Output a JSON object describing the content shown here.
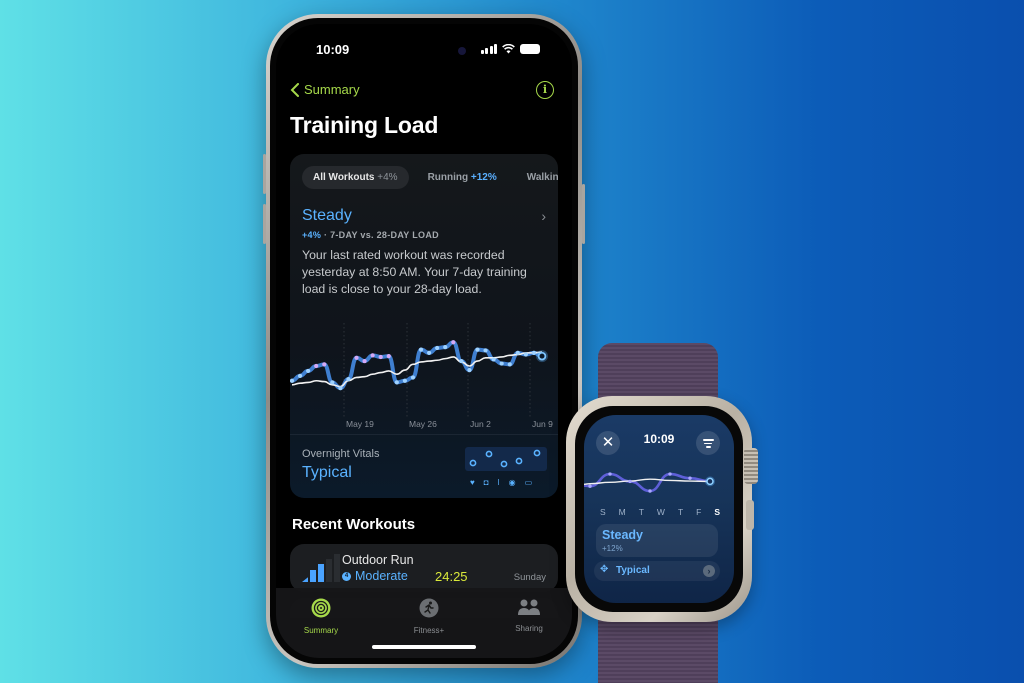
{
  "colors": {
    "accent_green": "#a6d94a",
    "accent_blue": "#5ab2ff",
    "time_yellow": "#d9e83a",
    "high_load_purple": "#b27bdc"
  },
  "phone": {
    "status_bar": {
      "time": "10:09"
    },
    "nav": {
      "back_label": "Summary",
      "info_icon": "info-icon"
    },
    "title": "Training Load",
    "tabs": [
      {
        "label": "All Workouts",
        "delta": "+4%",
        "active": true
      },
      {
        "label": "Running",
        "delta": "+12%",
        "active": false
      },
      {
        "label": "Walkin",
        "delta": "",
        "active": false
      }
    ],
    "load": {
      "state": "Steady",
      "change": "+4%",
      "comparison": "· 7-DAY vs. 28-DAY LOAD",
      "description": "Your last rated workout was recorded yesterday at 8:50 AM. Your 7-day training load is close to your 28-day load."
    },
    "chart_data": {
      "type": "line",
      "x_ticks": [
        "May 19",
        "May 26",
        "Jun 2",
        "Jun 9"
      ],
      "series": [
        {
          "name": "7-day load",
          "values": [
            0.32,
            0.38,
            0.44,
            0.5,
            0.52,
            0.3,
            0.23,
            0.34,
            0.6,
            0.56,
            0.63,
            0.61,
            0.62,
            0.3,
            0.32,
            0.36,
            0.7,
            0.66,
            0.72,
            0.73,
            0.79,
            0.56,
            0.45,
            0.7,
            0.69,
            0.58,
            0.53,
            0.52,
            0.66,
            0.64,
            0.66,
            0.62
          ]
        },
        {
          "name": "28-day load",
          "values": [
            0.27,
            0.29,
            0.3,
            0.32,
            0.31,
            0.27,
            0.25,
            0.32,
            0.36,
            0.37,
            0.4,
            0.42,
            0.44,
            0.4,
            0.45,
            0.52,
            0.55,
            0.56,
            0.57,
            0.59,
            0.61,
            0.55,
            0.5,
            0.56,
            0.6,
            0.6,
            0.61,
            0.63,
            0.64,
            0.66,
            0.66,
            0.67
          ]
        }
      ]
    },
    "vitals": {
      "label": "Overnight Vitals",
      "value": "Typical",
      "metric_icons": [
        "heart-icon",
        "lungs-icon",
        "thermometer-icon",
        "blood-oxygen-icon",
        "bed-icon"
      ],
      "metric_glyphs": [
        "♥",
        "◘",
        "ǀ",
        "◉",
        "▭"
      ]
    },
    "recent_workouts": {
      "title": "Recent Workouts",
      "items": [
        {
          "name": "Outdoor Run",
          "effort": "Moderate",
          "effort_badge": "4",
          "duration": "24:25",
          "day": "Sunday"
        }
      ]
    },
    "tab_bar": [
      {
        "label": "Summary",
        "icon": "activity-rings-icon",
        "active": true
      },
      {
        "label": "Fitness+",
        "icon": "running-figure-icon",
        "active": false
      },
      {
        "label": "Sharing",
        "icon": "people-icon",
        "active": false
      }
    ]
  },
  "watch": {
    "time": "10:09",
    "close_icon": "✕",
    "chart_data": {
      "type": "line",
      "x_ticks": [
        "S",
        "M",
        "T",
        "W",
        "T",
        "F",
        "S"
      ],
      "series": [
        {
          "name": "7-day load",
          "values": [
            0.4,
            0.78,
            0.55,
            0.25,
            0.78,
            0.65,
            0.55
          ]
        },
        {
          "name": "28-day load",
          "values": [
            0.48,
            0.52,
            0.56,
            0.62,
            0.58,
            0.56,
            0.55
          ]
        }
      ]
    },
    "state": "Steady",
    "change": "+12%",
    "vitals_label": "Typical",
    "vitals_chevron": "›"
  }
}
